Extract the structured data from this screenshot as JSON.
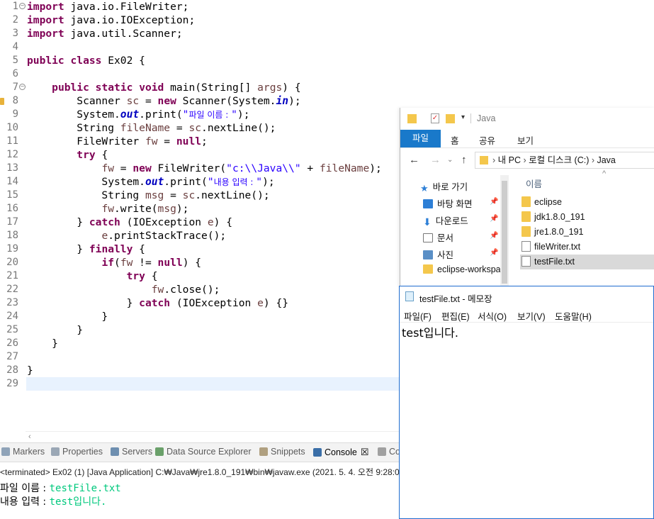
{
  "editor": {
    "line_numbers": [
      "1",
      "2",
      "3",
      "4",
      "5",
      "6",
      "7",
      "8",
      "9",
      "10",
      "11",
      "12",
      "13",
      "14",
      "15",
      "16",
      "17",
      "18",
      "19",
      "20",
      "21",
      "22",
      "23",
      "24",
      "25",
      "26",
      "27",
      "28",
      "29"
    ],
    "lines": [
      [
        {
          "t": "kw",
          "v": "import"
        },
        {
          "t": "p",
          "v": " java.io.FileWriter;"
        }
      ],
      [
        {
          "t": "kw",
          "v": "import"
        },
        {
          "t": "p",
          "v": " java.io.IOException;"
        }
      ],
      [
        {
          "t": "kw",
          "v": "import"
        },
        {
          "t": "p",
          "v": " java.util.Scanner;"
        }
      ],
      [],
      [
        {
          "t": "kw",
          "v": "public"
        },
        {
          "t": "p",
          "v": " "
        },
        {
          "t": "kw",
          "v": "class"
        },
        {
          "t": "p",
          "v": " Ex02 {"
        }
      ],
      [],
      [
        {
          "t": "p",
          "v": "    "
        },
        {
          "t": "kw",
          "v": "public"
        },
        {
          "t": "p",
          "v": " "
        },
        {
          "t": "kw",
          "v": "static"
        },
        {
          "t": "p",
          "v": " "
        },
        {
          "t": "kw",
          "v": "void"
        },
        {
          "t": "p",
          "v": " main(String[] "
        },
        {
          "t": "var",
          "v": "args"
        },
        {
          "t": "p",
          "v": ") {"
        }
      ],
      [
        {
          "t": "p",
          "v": "        Scanner "
        },
        {
          "t": "var",
          "v": "sc"
        },
        {
          "t": "p",
          "v": " = "
        },
        {
          "t": "kw",
          "v": "new"
        },
        {
          "t": "p",
          "v": " Scanner(System."
        },
        {
          "t": "fld",
          "v": "in"
        },
        {
          "t": "p",
          "v": ");"
        }
      ],
      [
        {
          "t": "p",
          "v": "        System."
        },
        {
          "t": "fld",
          "v": "out"
        },
        {
          "t": "p",
          "v": ".print("
        },
        {
          "t": "str",
          "v": "\""
        },
        {
          "t": "strko",
          "v": "파일 이름 : "
        },
        {
          "t": "str",
          "v": "\""
        },
        {
          "t": "p",
          "v": ");"
        }
      ],
      [
        {
          "t": "p",
          "v": "        String "
        },
        {
          "t": "var",
          "v": "fileName"
        },
        {
          "t": "p",
          "v": " = "
        },
        {
          "t": "var",
          "v": "sc"
        },
        {
          "t": "p",
          "v": ".nextLine();"
        }
      ],
      [
        {
          "t": "p",
          "v": "        FileWriter "
        },
        {
          "t": "var",
          "v": "fw"
        },
        {
          "t": "p",
          "v": " = "
        },
        {
          "t": "kw",
          "v": "null"
        },
        {
          "t": "p",
          "v": ";"
        }
      ],
      [
        {
          "t": "p",
          "v": "        "
        },
        {
          "t": "kw",
          "v": "try"
        },
        {
          "t": "p",
          "v": " {"
        }
      ],
      [
        {
          "t": "p",
          "v": "            "
        },
        {
          "t": "var",
          "v": "fw"
        },
        {
          "t": "p",
          "v": " = "
        },
        {
          "t": "kw",
          "v": "new"
        },
        {
          "t": "p",
          "v": " FileWriter("
        },
        {
          "t": "str",
          "v": "\"c:\\\\Java\\\\\""
        },
        {
          "t": "p",
          "v": " + "
        },
        {
          "t": "var",
          "v": "fileName"
        },
        {
          "t": "p",
          "v": ");"
        }
      ],
      [
        {
          "t": "p",
          "v": "            System."
        },
        {
          "t": "fld",
          "v": "out"
        },
        {
          "t": "p",
          "v": ".print("
        },
        {
          "t": "str",
          "v": "\""
        },
        {
          "t": "strko",
          "v": "내용 입력 : "
        },
        {
          "t": "str",
          "v": "\""
        },
        {
          "t": "p",
          "v": ");"
        }
      ],
      [
        {
          "t": "p",
          "v": "            String "
        },
        {
          "t": "var",
          "v": "msg"
        },
        {
          "t": "p",
          "v": " = "
        },
        {
          "t": "var",
          "v": "sc"
        },
        {
          "t": "p",
          "v": ".nextLine();"
        }
      ],
      [
        {
          "t": "p",
          "v": "            "
        },
        {
          "t": "var",
          "v": "fw"
        },
        {
          "t": "p",
          "v": ".write("
        },
        {
          "t": "var",
          "v": "msg"
        },
        {
          "t": "p",
          "v": ");"
        }
      ],
      [
        {
          "t": "p",
          "v": "        } "
        },
        {
          "t": "kw",
          "v": "catch"
        },
        {
          "t": "p",
          "v": " (IOException "
        },
        {
          "t": "var",
          "v": "e"
        },
        {
          "t": "p",
          "v": ") {"
        }
      ],
      [
        {
          "t": "p",
          "v": "            "
        },
        {
          "t": "var",
          "v": "e"
        },
        {
          "t": "p",
          "v": ".printStackTrace();"
        }
      ],
      [
        {
          "t": "p",
          "v": "        } "
        },
        {
          "t": "kw",
          "v": "finally"
        },
        {
          "t": "p",
          "v": " {"
        }
      ],
      [
        {
          "t": "p",
          "v": "            "
        },
        {
          "t": "kw",
          "v": "if"
        },
        {
          "t": "p",
          "v": "("
        },
        {
          "t": "var",
          "v": "fw"
        },
        {
          "t": "p",
          "v": " != "
        },
        {
          "t": "kw",
          "v": "null"
        },
        {
          "t": "p",
          "v": ") {"
        }
      ],
      [
        {
          "t": "p",
          "v": "                "
        },
        {
          "t": "kw",
          "v": "try"
        },
        {
          "t": "p",
          "v": " {"
        }
      ],
      [
        {
          "t": "p",
          "v": "                    "
        },
        {
          "t": "var",
          "v": "fw"
        },
        {
          "t": "p",
          "v": ".close();"
        }
      ],
      [
        {
          "t": "p",
          "v": "                } "
        },
        {
          "t": "kw",
          "v": "catch"
        },
        {
          "t": "p",
          "v": " (IOException "
        },
        {
          "t": "var",
          "v": "e"
        },
        {
          "t": "p",
          "v": ") {}"
        }
      ],
      [
        {
          "t": "p",
          "v": "            }"
        }
      ],
      [
        {
          "t": "p",
          "v": "        }"
        }
      ],
      [
        {
          "t": "p",
          "v": "    }"
        }
      ],
      [],
      [
        {
          "t": "p",
          "v": "}"
        }
      ],
      []
    ]
  },
  "console": {
    "tabs": [
      {
        "label": "Markers",
        "icon": "markers-icon"
      },
      {
        "label": "Properties",
        "icon": "properties-icon"
      },
      {
        "label": "Servers",
        "icon": "servers-icon"
      },
      {
        "label": "Data Source Explorer",
        "icon": "database-icon"
      },
      {
        "label": "Snippets",
        "icon": "snippets-icon"
      },
      {
        "label": "Console",
        "icon": "console-icon",
        "active": true,
        "close": "☒"
      },
      {
        "label": "Co",
        "icon": "coverage-icon"
      }
    ],
    "status": "<terminated> Ex02 (1) [Java Application] C:₩Java₩jre1.8.0_191₩bin₩javaw.exe (2021. 5. 4. 오전 9:28:09",
    "output": [
      {
        "label": "파일 이름 : ",
        "input": "testFile.txt"
      },
      {
        "label": "내용 입력 : ",
        "input": "test입니다."
      }
    ]
  },
  "explorer": {
    "title": "Java",
    "ribbon_tabs": [
      "파일",
      "홈",
      "공유",
      "보기"
    ],
    "breadcrumb": [
      "내 PC",
      "로컬 디스크 (C:)",
      "Java"
    ],
    "column_header": "이름",
    "nav_items": [
      {
        "label": "바로 가기",
        "icon": "star-icon",
        "pinned": false
      },
      {
        "label": "바탕 화면",
        "icon": "desktop-icon",
        "pinned": true
      },
      {
        "label": "다운로드",
        "icon": "download-icon",
        "pinned": true
      },
      {
        "label": "문서",
        "icon": "document-icon",
        "pinned": true
      },
      {
        "label": "사진",
        "icon": "picture-icon",
        "pinned": true
      },
      {
        "label": "eclipse-workspa",
        "icon": "folder-icon",
        "pinned": false
      }
    ],
    "files": [
      {
        "name": "eclipse",
        "type": "folder"
      },
      {
        "name": "jdk1.8.0_191",
        "type": "folder"
      },
      {
        "name": "jre1.8.0_191",
        "type": "folder"
      },
      {
        "name": "fileWriter.txt",
        "type": "text"
      },
      {
        "name": "testFile.txt",
        "type": "text",
        "selected": true
      }
    ]
  },
  "notepad": {
    "title": "testFile.txt - 메모장",
    "menu": [
      "파일(F)",
      "편집(E)",
      "서식(O)",
      "보기(V)",
      "도움말(H)"
    ],
    "content": "test입니다."
  },
  "colors": {
    "keyword": "#7f0055",
    "string": "#2a00ff",
    "field": "#0000c0",
    "variable": "#6a3e3e",
    "console_input": "#00c87d",
    "ribbon_file": "#1979ca",
    "selection": "#cce8ff",
    "current_line": "#e8f2fe"
  }
}
